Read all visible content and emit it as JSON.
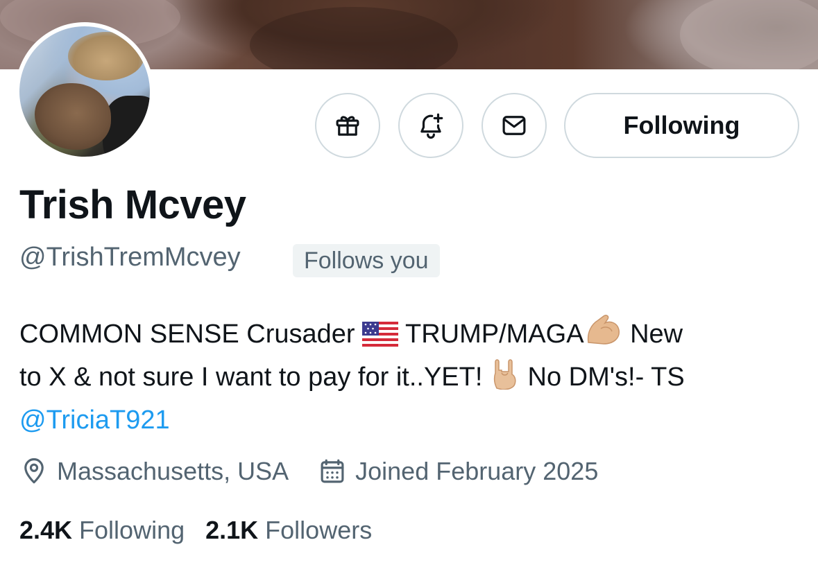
{
  "profile": {
    "name": "Trish Mcvey",
    "handle": "@TrishTremMcvey",
    "follows_you": "Follows you",
    "bio": {
      "line1_a": "COMMON SENSE Crusader",
      "line1_b": "TRUMP/MAGA",
      "line1_c": "New",
      "line2_a": "to X & not sure I want to pay for it..YET!",
      "line2_b": "No DM's!- TS",
      "mention": "@TriciaT921",
      "emojis": [
        "us-flag-icon",
        "flexed-biceps-icon",
        "sign-of-horns-icon"
      ]
    },
    "location": "Massachusetts, USA",
    "joined": "Joined February 2025",
    "following_count": "2.4K",
    "following_label": "Following",
    "followers_count": "2.1K",
    "followers_label": "Followers"
  },
  "actions": {
    "gift_icon": "gift-icon",
    "notify_icon": "bell-plus-icon",
    "message_icon": "envelope-icon",
    "follow_button_label": "Following"
  },
  "colors": {
    "text_primary": "#0f1419",
    "text_secondary": "#536471",
    "link": "#1d9bf0",
    "border": "#cfd9de",
    "badge_bg": "#eff3f4"
  }
}
